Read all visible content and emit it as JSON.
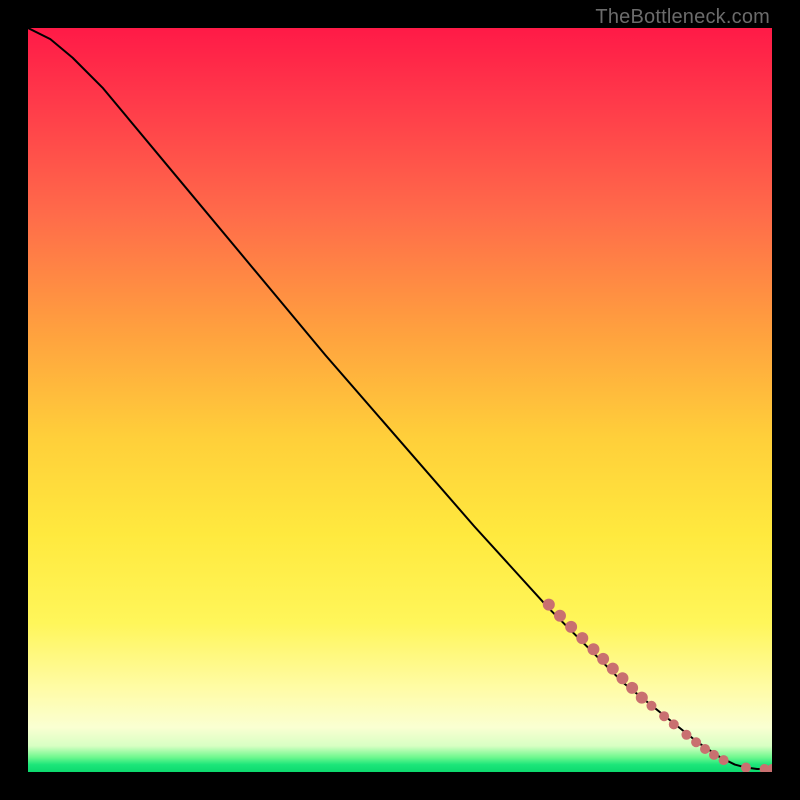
{
  "branding": "TheBottleneck.com",
  "chart_data": {
    "type": "line",
    "title": "",
    "xlabel": "",
    "ylabel": "",
    "xlim": [
      0,
      100
    ],
    "ylim": [
      0,
      100
    ],
    "series": [
      {
        "name": "curve",
        "x": [
          0,
          3,
          6,
          10,
          20,
          30,
          40,
          50,
          60,
          70,
          75,
          80,
          85,
          90,
          93,
          95,
          96.5,
          98,
          100
        ],
        "y": [
          100,
          98.5,
          96,
          92,
          80,
          68,
          56,
          44.5,
          33,
          22,
          17,
          12,
          8,
          4,
          2,
          1,
          0.6,
          0.4,
          0.4
        ]
      }
    ],
    "markers": [
      {
        "x": 70.0,
        "y": 22.5,
        "r": 6
      },
      {
        "x": 71.5,
        "y": 21.0,
        "r": 6
      },
      {
        "x": 73.0,
        "y": 19.5,
        "r": 6
      },
      {
        "x": 74.5,
        "y": 18.0,
        "r": 6
      },
      {
        "x": 76.0,
        "y": 16.5,
        "r": 6
      },
      {
        "x": 77.3,
        "y": 15.2,
        "r": 6
      },
      {
        "x": 78.6,
        "y": 13.9,
        "r": 6
      },
      {
        "x": 79.9,
        "y": 12.6,
        "r": 6
      },
      {
        "x": 81.2,
        "y": 11.3,
        "r": 6
      },
      {
        "x": 82.5,
        "y": 10.0,
        "r": 6
      },
      {
        "x": 83.8,
        "y": 8.9,
        "r": 5
      },
      {
        "x": 85.5,
        "y": 7.5,
        "r": 5
      },
      {
        "x": 86.8,
        "y": 6.4,
        "r": 5
      },
      {
        "x": 88.5,
        "y": 5.0,
        "r": 5
      },
      {
        "x": 89.8,
        "y": 4.0,
        "r": 5
      },
      {
        "x": 91.0,
        "y": 3.1,
        "r": 5
      },
      {
        "x": 92.2,
        "y": 2.3,
        "r": 5
      },
      {
        "x": 93.5,
        "y": 1.6,
        "r": 5
      },
      {
        "x": 96.5,
        "y": 0.6,
        "r": 5
      },
      {
        "x": 99.0,
        "y": 0.4,
        "r": 5
      },
      {
        "x": 100.0,
        "y": 0.4,
        "r": 5
      }
    ],
    "gradient_stops": [
      {
        "pos": 0,
        "color": "#ff1a47"
      },
      {
        "pos": 0.55,
        "color": "#ffcf3a"
      },
      {
        "pos": 0.9,
        "color": "#fffca8"
      },
      {
        "pos": 1.0,
        "color": "#0cd96e"
      }
    ]
  }
}
